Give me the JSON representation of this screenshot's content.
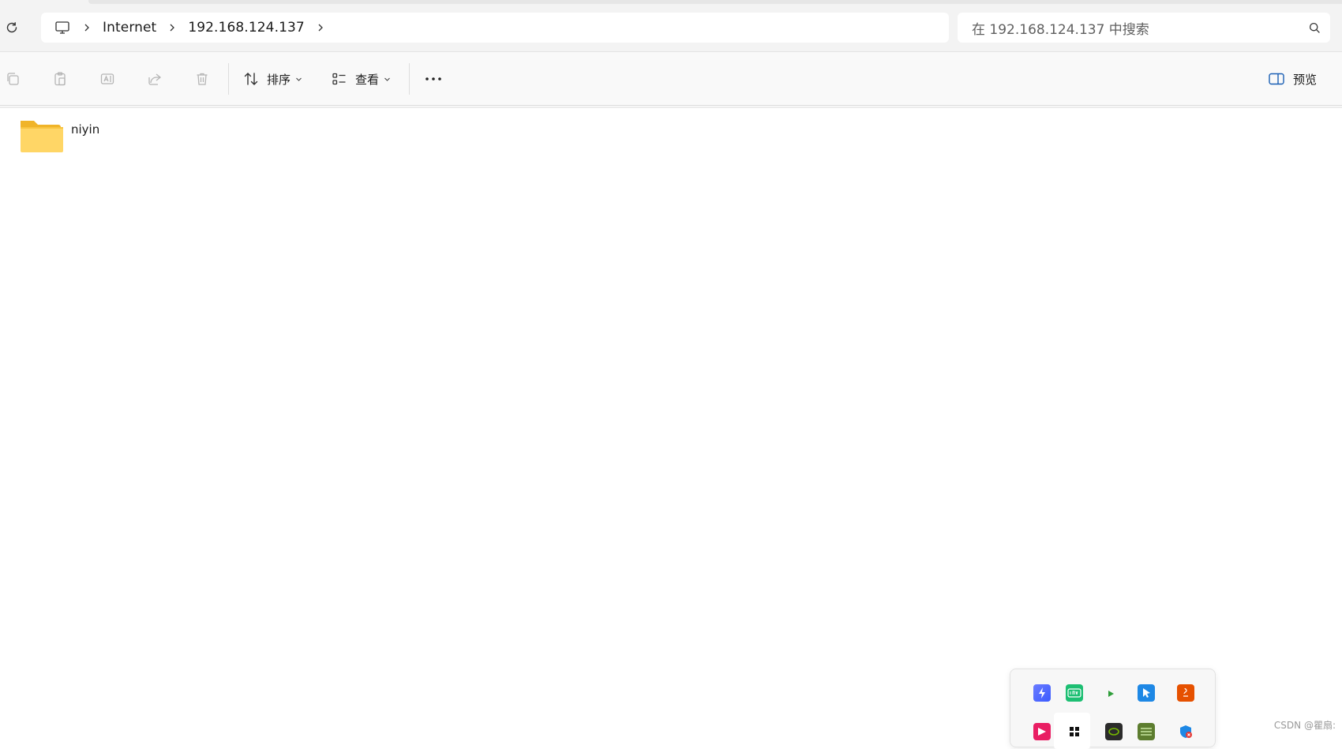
{
  "address_bar": {
    "breadcrumbs": [
      {
        "icon": "monitor-icon"
      },
      {
        "label": "Internet"
      },
      {
        "label": "192.168.124.137"
      }
    ]
  },
  "search": {
    "placeholder": "在 192.168.124.137 中搜索"
  },
  "toolbar": {
    "icons": [
      "copy-icon",
      "paste-icon",
      "rename-icon",
      "share-icon",
      "delete-icon"
    ],
    "sort_label": "排序",
    "view_label": "查看",
    "more_label": "···",
    "preview_label": "预览"
  },
  "files": [
    {
      "name": "niyin",
      "icon": "folder-icon"
    }
  ],
  "tray": {
    "icons": [
      "tray-app-1",
      "tray-app-iqiyi",
      "tray-app-play",
      "tray-app-4",
      "tray-app-java",
      "tray-app-6",
      "tray-app-7",
      "tray-app-nvidia",
      "tray-app-9",
      "tray-app-security"
    ]
  },
  "watermark": "CSDN @瞿扇:"
}
